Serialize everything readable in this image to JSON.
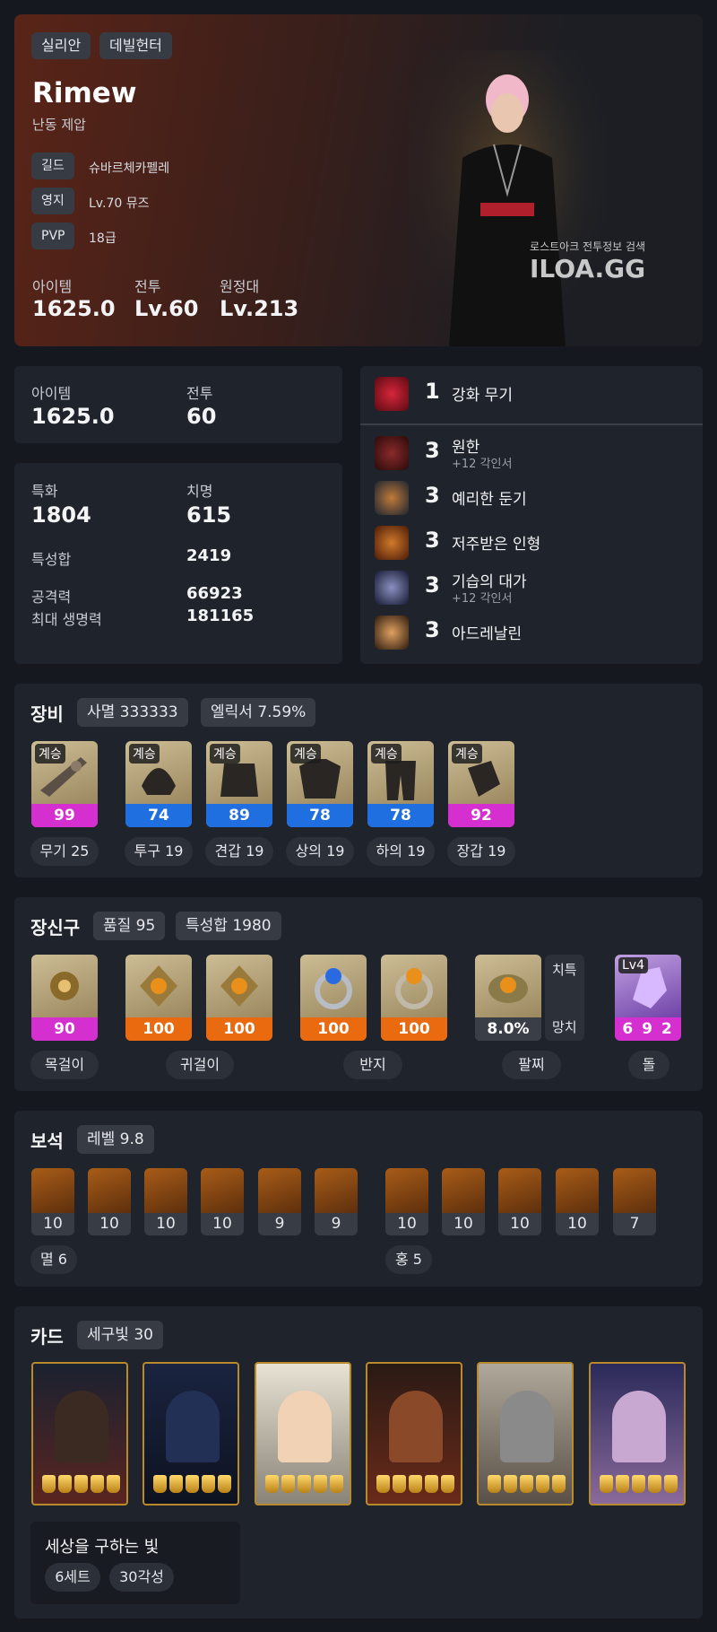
{
  "profile": {
    "server": "실리안",
    "class": "데빌헌터",
    "name": "Rimew",
    "title": "난동 제압",
    "guild_label": "길드",
    "guild": "슈바르체카펠레",
    "estate_label": "영지",
    "estate": "Lv.70 뮤즈",
    "pvp_label": "PVP",
    "pvp": "18급",
    "item_label": "아이템",
    "item_level": "1625.0",
    "combat_label": "전투",
    "combat_level": "Lv.60",
    "expedition_label": "원정대",
    "expedition_level": "Lv.213",
    "watermark_small": "로스트아크 전투정보 검색",
    "watermark_big": "ILOA.GG"
  },
  "summary": {
    "item_label": "아이템",
    "item_level": "1625.0",
    "combat_label": "전투",
    "combat_level": "60"
  },
  "stats": {
    "spec_label": "특화",
    "spec": "1804",
    "crit_label": "치명",
    "crit": "615",
    "total_label": "특성합",
    "total": "2419",
    "atk_label": "공격력",
    "atk": "66923",
    "hp_label": "최대 생명력",
    "hp": "181165"
  },
  "engravings": [
    {
      "level": "1",
      "name": "강화 무기",
      "sub": "",
      "icon": "crimson-sword-icon",
      "color": "#8b1220"
    },
    {
      "level": "3",
      "name": "원한",
      "sub": "+12 각인서",
      "icon": "demon-face-icon",
      "color": "#5a1418"
    },
    {
      "level": "3",
      "name": "예리한 둔기",
      "sub": "",
      "icon": "dark-orb-icon",
      "color": "#1c2a38"
    },
    {
      "level": "3",
      "name": "저주받은 인형",
      "sub": "",
      "icon": "cursed-doll-icon",
      "color": "#7a3a10"
    },
    {
      "level": "3",
      "name": "기습의 대가",
      "sub": "+12 각인서",
      "icon": "moon-blade-icon",
      "color": "#1e2440"
    },
    {
      "level": "3",
      "name": "아드레날린",
      "sub": "",
      "icon": "burst-man-icon",
      "color": "#3b2a1a"
    }
  ],
  "equipment": {
    "title": "장비",
    "pill1": "사멸 333333",
    "pill2": "엘릭서 7.59%",
    "tag": "계승",
    "items": [
      {
        "icon": "gun-icon",
        "quality": "99",
        "bar": "#d62fd0",
        "label": "무기 25"
      },
      {
        "icon": "helmet-icon",
        "quality": "74",
        "bar": "#1f6fe0",
        "label": "투구 19"
      },
      {
        "icon": "shoulder-icon",
        "quality": "89",
        "bar": "#1f6fe0",
        "label": "견갑 19"
      },
      {
        "icon": "chest-armor-icon",
        "quality": "78",
        "bar": "#1f6fe0",
        "label": "상의 19"
      },
      {
        "icon": "pants-icon",
        "quality": "78",
        "bar": "#1f6fe0",
        "label": "하의 19"
      },
      {
        "icon": "gloves-icon",
        "quality": "92",
        "bar": "#d62fd0",
        "label": "장갑 19"
      }
    ]
  },
  "accessories": {
    "title": "장신구",
    "pill1": "품질 95",
    "pill2": "특성합 1980",
    "items": [
      {
        "icon": "necklace-icon",
        "quality": "90",
        "bar": "#d62fd0"
      },
      {
        "icon": "earring-icon",
        "quality": "100",
        "bar": "#ea6a10"
      },
      {
        "icon": "earring-icon",
        "quality": "100",
        "bar": "#ea6a10"
      },
      {
        "icon": "ring-blue-icon",
        "quality": "100",
        "bar": "#ea6a10"
      },
      {
        "icon": "ring-gold-icon",
        "quality": "100",
        "bar": "#ea6a10"
      },
      {
        "icon": "bracelet-icon",
        "quality": "8.0%",
        "bar": "#3a3e47"
      },
      {
        "icon": "stone-icon",
        "quality": "6 9 2",
        "bar": "#d62fd0"
      }
    ],
    "bracelet_stat1": "치특",
    "bracelet_stat2": "망치",
    "stone_level": "Lv4",
    "labels": [
      "목걸이",
      "귀걸이",
      "반지",
      "팔찌",
      "돌"
    ]
  },
  "gems": {
    "title": "보석",
    "pill": "레벨 9.8",
    "values": [
      "10",
      "10",
      "10",
      "10",
      "9",
      "9",
      "10",
      "10",
      "10",
      "10",
      "7"
    ],
    "label_left": "멸 6",
    "label_right": "홍 5"
  },
  "cards": {
    "title": "카드",
    "pill": "세구빛 30",
    "items": [
      {
        "icon": "card-hooded-man-icon"
      },
      {
        "icon": "card-dark-knight-icon"
      },
      {
        "icon": "card-angel-icon"
      },
      {
        "icon": "card-armored-giant-icon"
      },
      {
        "icon": "card-silver-knight-icon"
      },
      {
        "icon": "card-twin-goddess-icon"
      }
    ],
    "set_name": "세상을 구하는 빛",
    "set_count": "6세트",
    "set_awaken": "30각성"
  }
}
